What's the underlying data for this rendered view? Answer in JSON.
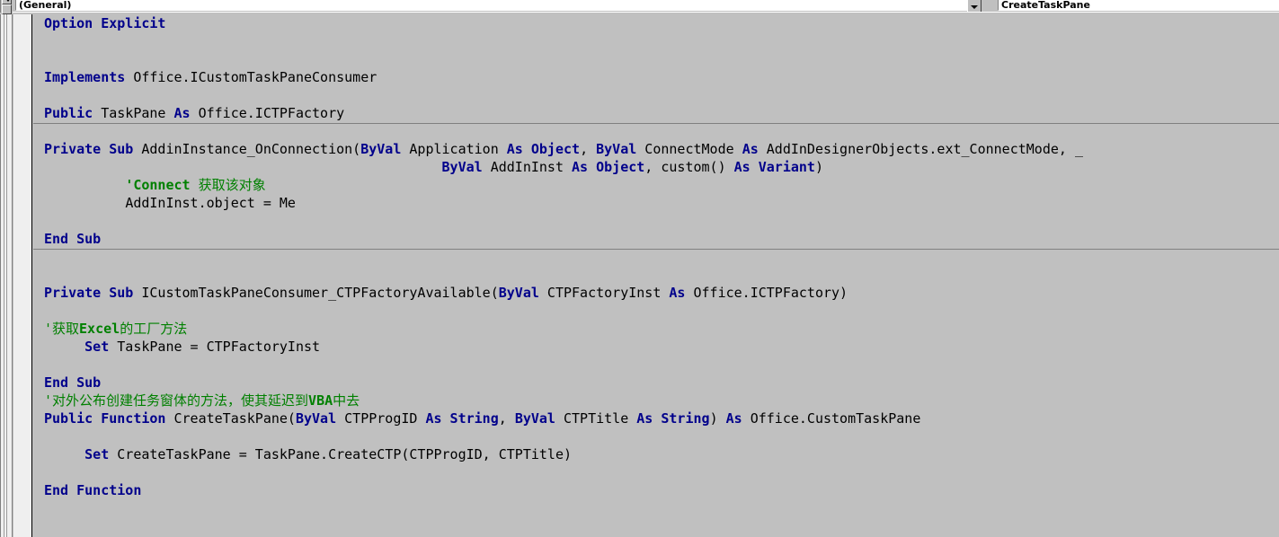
{
  "window": {
    "title": "Visual Basic Editor - Code Window",
    "background_color": "#c0c0c0"
  },
  "toolbar": {
    "object_combo": {
      "name": "object-dropdown",
      "value": "(General)",
      "arrow_icon": "chevron-down-icon"
    },
    "procedure_combo": {
      "name": "procedure-dropdown",
      "value": "CreateTaskPane",
      "arrow_icon": "chevron-down-icon"
    },
    "view_buttons": {
      "procedure_view_icon": "procedure-view-icon",
      "full_module_view_icon": "full-module-view-icon"
    }
  },
  "colors": {
    "keyword": "#00008b",
    "comment": "#008000",
    "text": "#000000",
    "editor_background": "#c0c0c0",
    "gutter_background": "#efefef",
    "separator": "#808080"
  },
  "editor": {
    "font_size_px": 15,
    "line_height_px": 20,
    "separators_y": [
      121,
      261
    ],
    "lines": [
      {
        "indent": 0,
        "tokens": [
          {
            "t": "kw",
            "v": "Option Explicit"
          }
        ]
      },
      {
        "indent": 0,
        "tokens": []
      },
      {
        "indent": 0,
        "tokens": []
      },
      {
        "indent": 0,
        "tokens": [
          {
            "t": "kw",
            "v": "Implements"
          },
          {
            "t": "pl",
            "v": " Office.ICustomTaskPaneConsumer"
          }
        ]
      },
      {
        "indent": 0,
        "tokens": []
      },
      {
        "indent": 0,
        "tokens": [
          {
            "t": "kw",
            "v": "Public"
          },
          {
            "t": "pl",
            "v": " TaskPane "
          },
          {
            "t": "kw",
            "v": "As"
          },
          {
            "t": "pl",
            "v": " Office.ICTPFactory"
          }
        ]
      },
      {
        "indent": 0,
        "tokens": []
      },
      {
        "indent": 0,
        "tokens": [
          {
            "t": "kw",
            "v": "Private Sub"
          },
          {
            "t": "pl",
            "v": " AddinInstance_OnConnection("
          },
          {
            "t": "kw",
            "v": "ByVal"
          },
          {
            "t": "pl",
            "v": " Application "
          },
          {
            "t": "kw",
            "v": "As Object"
          },
          {
            "t": "pl",
            "v": ", "
          },
          {
            "t": "kw",
            "v": "ByVal"
          },
          {
            "t": "pl",
            "v": " ConnectMode "
          },
          {
            "t": "kw",
            "v": "As"
          },
          {
            "t": "pl",
            "v": " AddInDesignerObjects.ext_ConnectMode, _"
          }
        ]
      },
      {
        "indent": 49,
        "tokens": [
          {
            "t": "kw",
            "v": "ByVal"
          },
          {
            "t": "pl",
            "v": " AddInInst "
          },
          {
            "t": "kw",
            "v": "As Object"
          },
          {
            "t": "pl",
            "v": ", custom() "
          },
          {
            "t": "kw",
            "v": "As Variant"
          },
          {
            "t": "pl",
            "v": ")"
          }
        ]
      },
      {
        "indent": 10,
        "tokens": [
          {
            "t": "cmb",
            "v": "'Connect"
          },
          {
            "t": "cm",
            "v": " 获取该对象"
          }
        ]
      },
      {
        "indent": 10,
        "tokens": [
          {
            "t": "pl",
            "v": "AddInInst.object = Me"
          }
        ]
      },
      {
        "indent": 0,
        "tokens": []
      },
      {
        "indent": 0,
        "tokens": [
          {
            "t": "kw",
            "v": "End Sub"
          }
        ]
      },
      {
        "indent": 0,
        "tokens": []
      },
      {
        "indent": 0,
        "tokens": []
      },
      {
        "indent": 0,
        "tokens": [
          {
            "t": "kw",
            "v": "Private Sub"
          },
          {
            "t": "pl",
            "v": " ICustomTaskPaneConsumer_CTPFactoryAvailable("
          },
          {
            "t": "kw",
            "v": "ByVal"
          },
          {
            "t": "pl",
            "v": " CTPFactoryInst "
          },
          {
            "t": "kw",
            "v": "As"
          },
          {
            "t": "pl",
            "v": " Office.ICTPFactory)"
          }
        ]
      },
      {
        "indent": 0,
        "tokens": []
      },
      {
        "indent": 0,
        "tokens": [
          {
            "t": "cm",
            "v": "'获取"
          },
          {
            "t": "cmb",
            "v": "Excel"
          },
          {
            "t": "cm",
            "v": "的工厂方法"
          }
        ]
      },
      {
        "indent": 5,
        "tokens": [
          {
            "t": "kw",
            "v": "Set"
          },
          {
            "t": "pl",
            "v": " TaskPane = CTPFactoryInst"
          }
        ]
      },
      {
        "indent": 0,
        "tokens": []
      },
      {
        "indent": 0,
        "tokens": [
          {
            "t": "kw",
            "v": "End Sub"
          }
        ]
      },
      {
        "indent": 0,
        "tokens": [
          {
            "t": "cm",
            "v": "'对外公布创建任务窗体的方法，使其延迟到"
          },
          {
            "t": "cmb",
            "v": "VBA"
          },
          {
            "t": "cm",
            "v": "中去"
          }
        ]
      },
      {
        "indent": 0,
        "tokens": [
          {
            "t": "kw",
            "v": "Public Function"
          },
          {
            "t": "pl",
            "v": " CreateTaskPane("
          },
          {
            "t": "kw",
            "v": "ByVal"
          },
          {
            "t": "pl",
            "v": " CTPProgID "
          },
          {
            "t": "kw",
            "v": "As String"
          },
          {
            "t": "pl",
            "v": ", "
          },
          {
            "t": "kw",
            "v": "ByVal"
          },
          {
            "t": "pl",
            "v": " CTPTitle "
          },
          {
            "t": "kw",
            "v": "As String"
          },
          {
            "t": "pl",
            "v": ") "
          },
          {
            "t": "kw",
            "v": "As"
          },
          {
            "t": "pl",
            "v": " Office.CustomTaskPane"
          }
        ]
      },
      {
        "indent": 0,
        "tokens": []
      },
      {
        "indent": 5,
        "tokens": [
          {
            "t": "kw",
            "v": "Set"
          },
          {
            "t": "pl",
            "v": " CreateTaskPane = TaskPane.CreateCTP(CTPProgID, CTPTitle)"
          }
        ]
      },
      {
        "indent": 0,
        "tokens": []
      },
      {
        "indent": 0,
        "tokens": [
          {
            "t": "kw",
            "v": "End Function"
          }
        ]
      }
    ]
  }
}
